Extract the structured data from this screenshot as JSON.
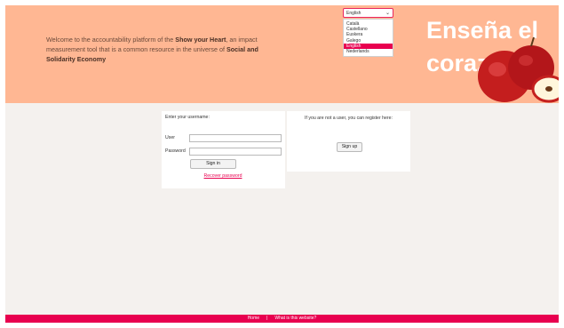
{
  "header": {
    "welcome": {
      "part1": "Welcome to the accountability platform of the ",
      "bold1": "Show your Heart",
      "part2": ", an impact measurement tool that is a common resource in the universe of ",
      "bold2": "Social and Solidarity Economy"
    },
    "brand_line1": "Enseña el",
    "brand_line2": "corazón"
  },
  "language": {
    "selected": "English",
    "options": [
      "Català",
      "Castellano",
      "Euskera",
      "Galego",
      "English",
      "Nederlands"
    ]
  },
  "login": {
    "title": "Enter your username:",
    "user_label": "User",
    "password_label": "Password",
    "signin_label": "Sign in",
    "recover_label": "Recover password"
  },
  "register": {
    "text": "If you are not a user, you can register here:",
    "signup_label": "Sign up"
  },
  "footer": {
    "home": "Home",
    "separator": "|",
    "about": "What is this website?"
  },
  "colors": {
    "header_bg": "#ffb793",
    "accent": "#e8004f",
    "page_bg": "#f4f1ee"
  }
}
